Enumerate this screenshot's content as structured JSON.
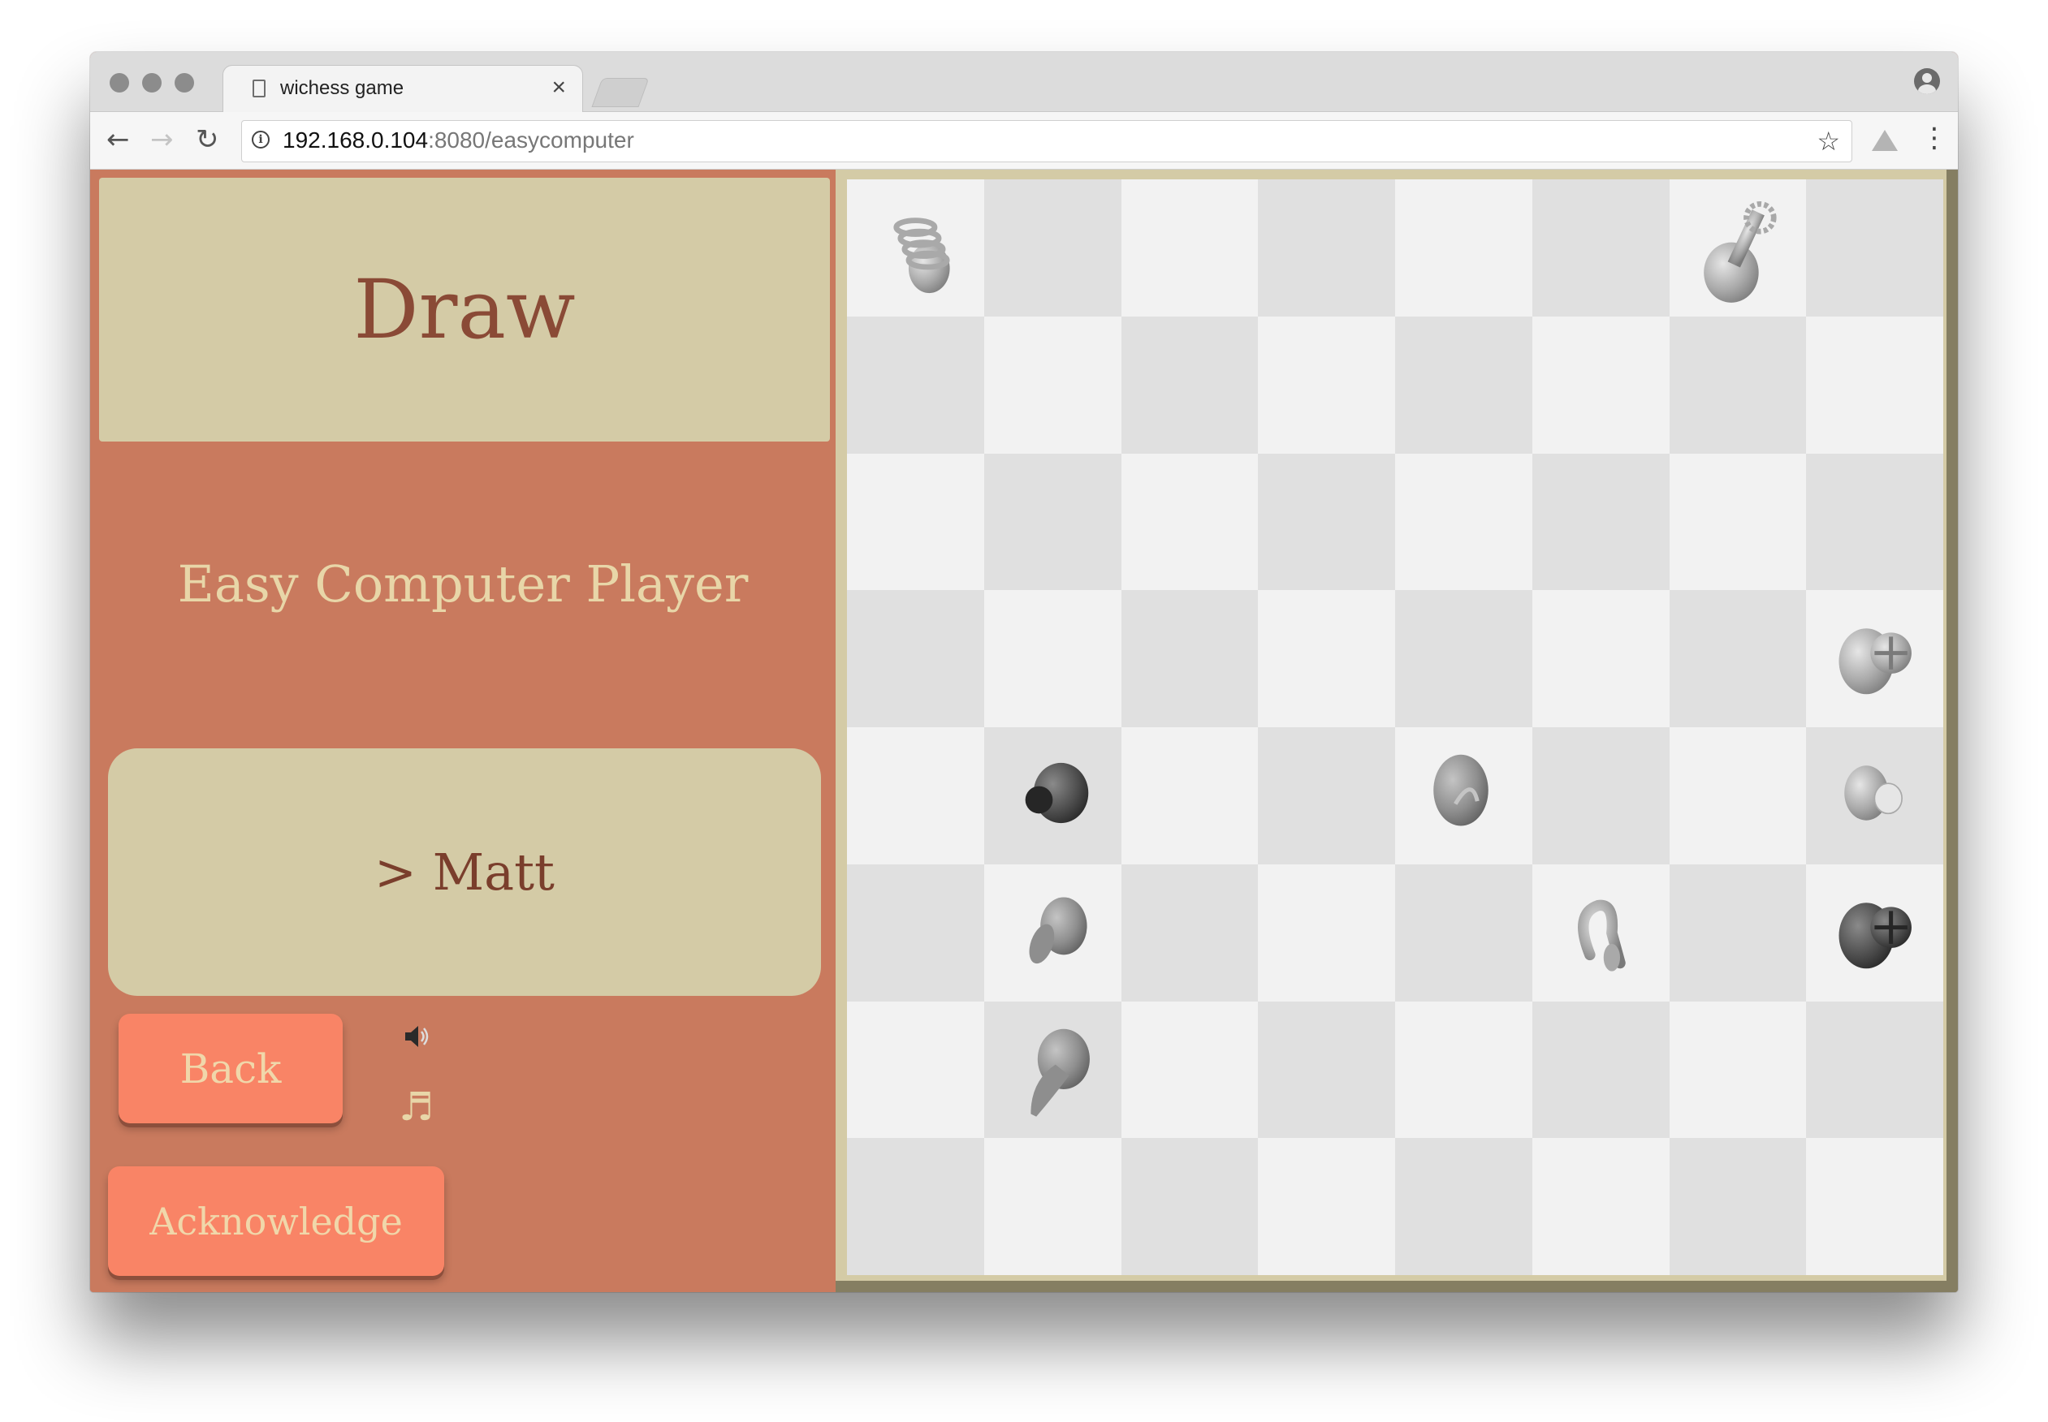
{
  "browser": {
    "tab_title": "wichess game",
    "tab_close": "×",
    "url_host": "192.168.0.104",
    "url_path": ":8080/easycomputer"
  },
  "game": {
    "status": "Draw",
    "opponent": "Easy Computer Player",
    "player": "> Matt",
    "back_label": "Back",
    "acknowledge_label": "Acknowledge",
    "music_glyph": "♬"
  },
  "board": {
    "pieces": [
      {
        "row": 0,
        "col": 0,
        "shade": "light",
        "type": "spring"
      },
      {
        "row": 0,
        "col": 6,
        "shade": "light",
        "type": "drill"
      },
      {
        "row": 3,
        "col": 7,
        "shade": "light",
        "type": "cross-head"
      },
      {
        "row": 4,
        "col": 1,
        "shade": "dark",
        "type": "knob"
      },
      {
        "row": 4,
        "col": 4,
        "shade": "medium",
        "type": "disc"
      },
      {
        "row": 4,
        "col": 7,
        "shade": "light",
        "type": "peg"
      },
      {
        "row": 5,
        "col": 1,
        "shade": "medium",
        "type": "mushroom"
      },
      {
        "row": 5,
        "col": 5,
        "shade": "light",
        "type": "hook"
      },
      {
        "row": 5,
        "col": 7,
        "shade": "dark",
        "type": "cross-head"
      },
      {
        "row": 6,
        "col": 1,
        "shade": "medium",
        "type": "cone"
      }
    ]
  }
}
